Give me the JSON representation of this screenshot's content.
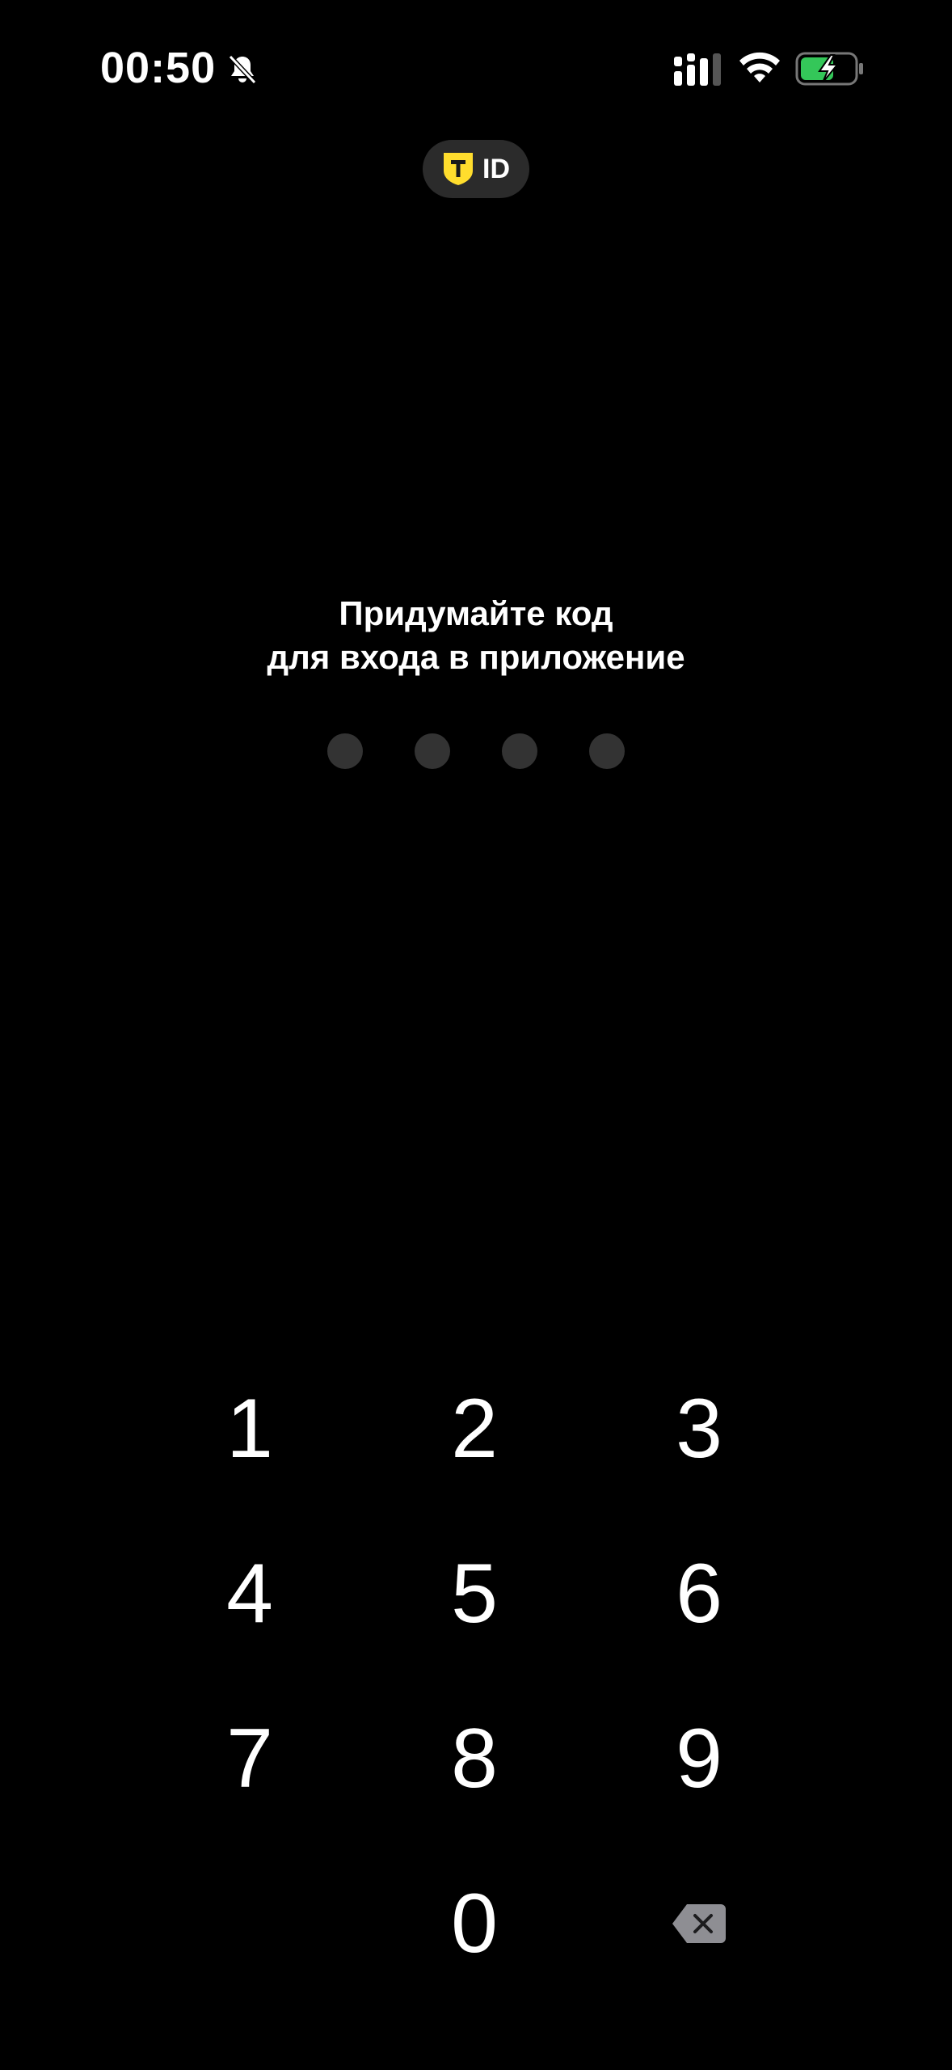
{
  "status_bar": {
    "time": "00:50",
    "icons": [
      "bell-slash-icon",
      "signal-icon",
      "wifi-icon",
      "battery-charging-icon"
    ],
    "battery_color": "#34c759"
  },
  "header": {
    "badge_letter": "T",
    "badge_text": "ID",
    "brand_color": "#ffdd2d"
  },
  "main": {
    "title_line1": "Придумайте код",
    "title_line2": "для входа в приложение",
    "pin_length": 4,
    "pin_entered": 0
  },
  "keypad": {
    "keys": [
      "1",
      "2",
      "3",
      "4",
      "5",
      "6",
      "7",
      "8",
      "9",
      "",
      "0",
      "backspace"
    ],
    "backspace_icon": "backspace-icon"
  }
}
